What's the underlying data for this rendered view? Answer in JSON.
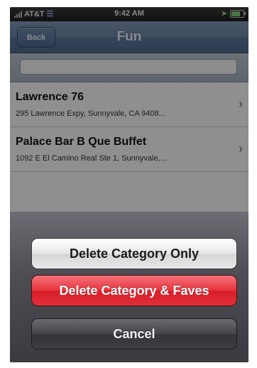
{
  "status_bar": {
    "carrier": "AT&T",
    "time": "9:42 AM"
  },
  "nav": {
    "back_label": "Back",
    "title": "Fun"
  },
  "search": {
    "value": ""
  },
  "list": [
    {
      "name": "Lawrence 76",
      "address": "295 Lawrence Expy, Sunnyvale, CA 9408..."
    },
    {
      "name": "Palace Bar B Que Buffet",
      "address": "1092 E El Camino Real Ste 1, Sunnyvale,..."
    }
  ],
  "action_sheet": {
    "delete_category_only": "Delete Category Only",
    "delete_category_and_faves": "Delete Category & Faves",
    "cancel": "Cancel"
  },
  "colors": {
    "nav_bar": "#6a83a4",
    "destructive": "#e0303a",
    "cancel": "#3c3c42"
  }
}
